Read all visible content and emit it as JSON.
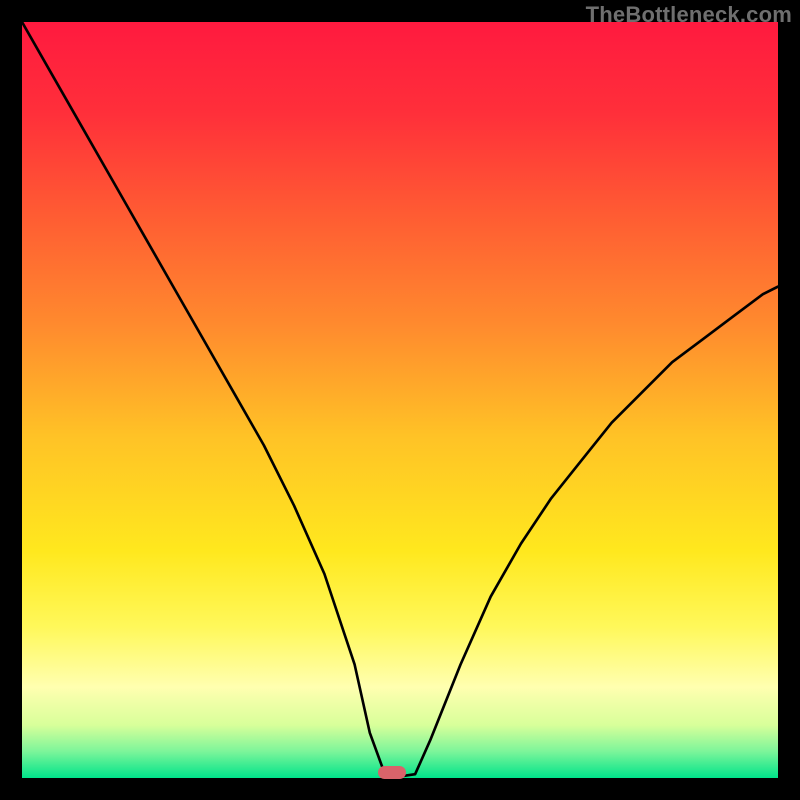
{
  "watermark": "TheBottleneck.com",
  "chart_data": {
    "type": "line",
    "title": "",
    "xlabel": "",
    "ylabel": "",
    "xlim": [
      0,
      100
    ],
    "ylim": [
      0,
      100
    ],
    "grid": false,
    "legend": false,
    "series": [
      {
        "name": "bottleneck-curve",
        "x": [
          0,
          4,
          8,
          12,
          16,
          20,
          24,
          28,
          32,
          36,
          40,
          44,
          46,
          48,
          50,
          52,
          54,
          58,
          62,
          66,
          70,
          74,
          78,
          82,
          86,
          90,
          94,
          98,
          100
        ],
        "y": [
          100,
          93,
          86,
          79,
          72,
          65,
          58,
          51,
          44,
          36,
          27,
          15,
          6,
          0.5,
          0.2,
          0.5,
          5,
          15,
          24,
          31,
          37,
          42,
          47,
          51,
          55,
          58,
          61,
          64,
          65
        ]
      }
    ],
    "marker": {
      "x": 49,
      "ymin": 0,
      "ymax": 1.5
    },
    "gradient_stops": [
      {
        "offset": 0.0,
        "color": "#ff1a3f"
      },
      {
        "offset": 0.12,
        "color": "#ff2f3a"
      },
      {
        "offset": 0.25,
        "color": "#ff5a33"
      },
      {
        "offset": 0.4,
        "color": "#ff8a2e"
      },
      {
        "offset": 0.55,
        "color": "#ffc326"
      },
      {
        "offset": 0.7,
        "color": "#ffe81e"
      },
      {
        "offset": 0.8,
        "color": "#fff85a"
      },
      {
        "offset": 0.88,
        "color": "#ffffb0"
      },
      {
        "offset": 0.93,
        "color": "#d8ff9a"
      },
      {
        "offset": 0.965,
        "color": "#7cf59a"
      },
      {
        "offset": 1.0,
        "color": "#00e38a"
      }
    ]
  }
}
